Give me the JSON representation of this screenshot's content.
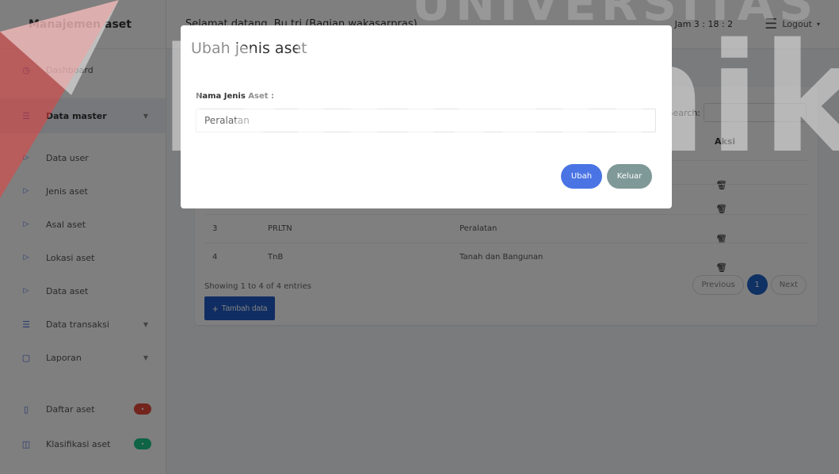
{
  "app": {
    "brand": "Manajemen aset"
  },
  "topbar": {
    "greeting": "Selamat datang, Bu tri (Bagian wakasarpras)",
    "time": "Jam 3 : 18 : 2",
    "logout_label": "Logout"
  },
  "sidebar": {
    "items": [
      {
        "label": "Dashboard",
        "icon": "dashboard-icon"
      },
      {
        "label": "Data master",
        "icon": "list-icon"
      },
      {
        "label": "Data user",
        "icon": "chevron-right-icon"
      },
      {
        "label": "Jenis aset",
        "icon": "chevron-right-icon"
      },
      {
        "label": "Asal aset",
        "icon": "chevron-right-icon"
      },
      {
        "label": "Lokasi aset",
        "icon": "chevron-right-icon"
      },
      {
        "label": "Data aset",
        "icon": "chevron-right-icon"
      },
      {
        "label": "Data transaksi",
        "icon": "list-icon"
      },
      {
        "label": "Laporan",
        "icon": "file-icon"
      },
      {
        "label": "Daftar aset",
        "icon": "book-icon",
        "badge": ""
      },
      {
        "label": "Klasifikasi aset",
        "icon": "columns-icon",
        "badge": ""
      }
    ],
    "badge_colors": {
      "red": "#e74a3b",
      "green": "#1cc88a"
    }
  },
  "table": {
    "search_label": "Search:",
    "col_aksi": "Aksi",
    "rows": [
      {
        "no": "3",
        "kode": "PRLTN",
        "nama": "Peralatan"
      },
      {
        "no": "4",
        "kode": "TnB",
        "nama": "Tanah dan Bangunan"
      }
    ],
    "info": "Showing 1 to 4 of 4 entries",
    "prev_label": "Previous",
    "page": "1",
    "next_label": "Next",
    "add_label": "Tambah data"
  },
  "modal": {
    "title": "Ubah jenis aset",
    "field_label": "Nama Jenis Aset :",
    "field_value": "Peralatan",
    "ubah_label": "Ubah",
    "keluar_label": "Keluar"
  },
  "watermark": {
    "top": "UNIVERSITAS",
    "main": "Dinamika"
  },
  "colors": {
    "primary": "#1e63c6",
    "ubah": "#4a74e4",
    "keluar": "#7f9898",
    "watermark_red": "#e8403f"
  }
}
